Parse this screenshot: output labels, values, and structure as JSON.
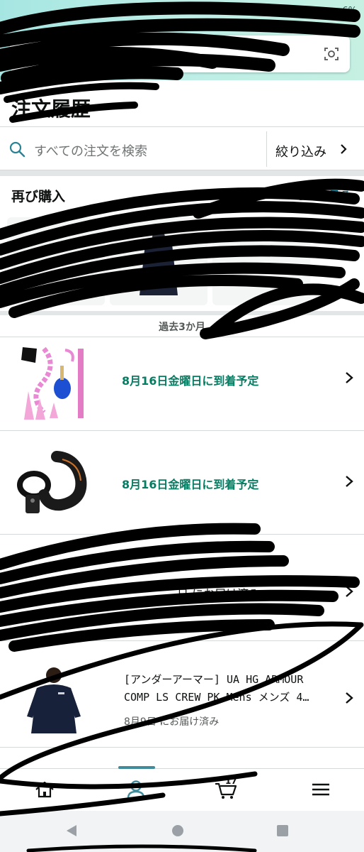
{
  "status_bar": {
    "battery": "6%"
  },
  "page": {
    "title": "注文履歴"
  },
  "order_search": {
    "placeholder": "すべての注文を検索",
    "filter_label": "絞り込み"
  },
  "buy_again": {
    "title": "再び購入",
    "see_all": "もっと見る"
  },
  "period": {
    "label": "過去3か月"
  },
  "orders": [
    {
      "status": "8月16日金曜日に到着予定",
      "status_color": "#067d62"
    },
    {
      "status": "8月16日金曜日に到着予定",
      "status_color": "#067d62"
    },
    {
      "status": "日 にお届け済み"
    },
    {
      "title": "[アンダーアーマー] UA HG ARMOUR COMP LS CREW PK Mens メンズ 4…",
      "delivered": "8月9日 にお届け済み"
    }
  ],
  "bottom_nav": {
    "items": [
      "home-icon",
      "account-icon",
      "cart-icon",
      "menu-icon"
    ],
    "cart_count": "17",
    "active": "account"
  },
  "colors": {
    "accent": "#418c9b",
    "green": "#067d62",
    "link": "#007185"
  }
}
